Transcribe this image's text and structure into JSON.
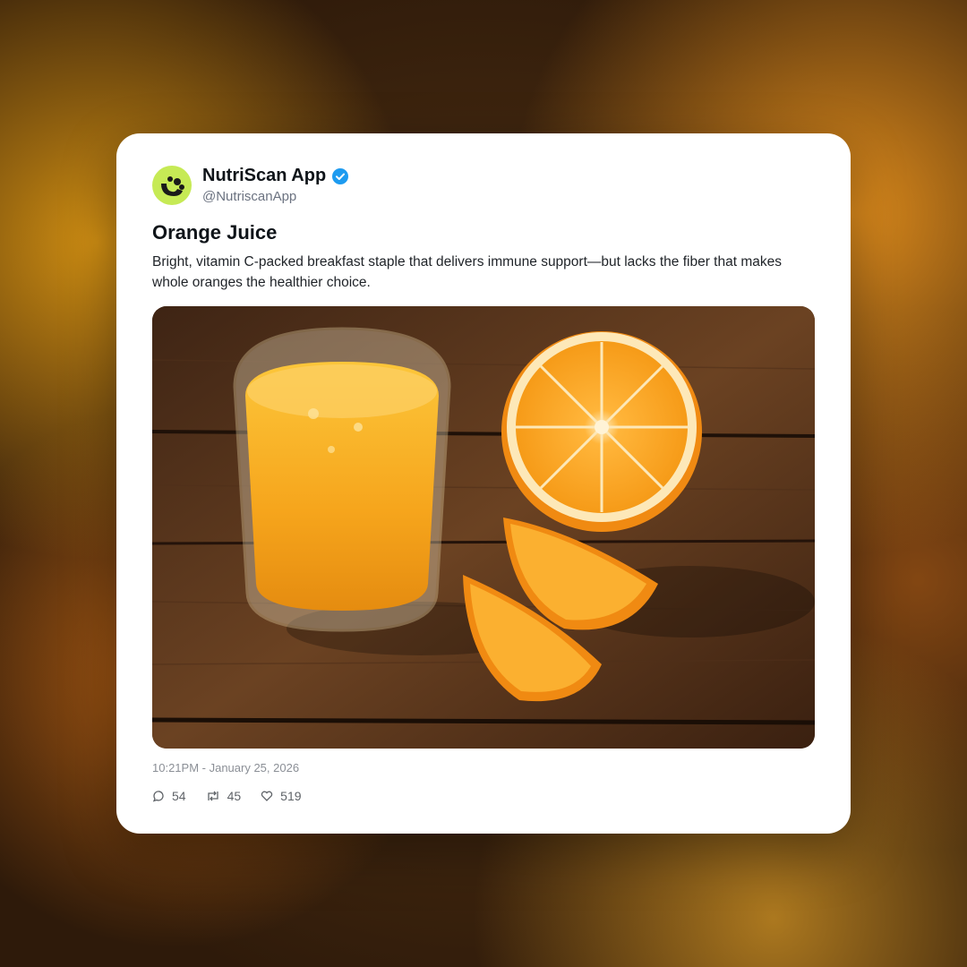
{
  "post": {
    "display_name": "NutriScan App",
    "handle": "@NutriscanApp",
    "verified": true,
    "title": "Orange Juice",
    "description": "Bright, vitamin C-packed breakfast staple that delivers immune support—but lacks the fiber that makes whole oranges the healthier choice.",
    "timestamp": "10:21PM - January 25, 2026",
    "replies": "54",
    "reposts": "45",
    "likes": "519"
  },
  "colors": {
    "avatar_bg": "#c6ea55",
    "verified_badge": "#1d9bf0",
    "juice": "#f6a51c",
    "orange_peel": "#f08a12"
  },
  "icons": {
    "reply": "comment-bubble-icon",
    "repost": "repost-arrows-icon",
    "like": "heart-icon",
    "verified": "verified-check-icon"
  }
}
